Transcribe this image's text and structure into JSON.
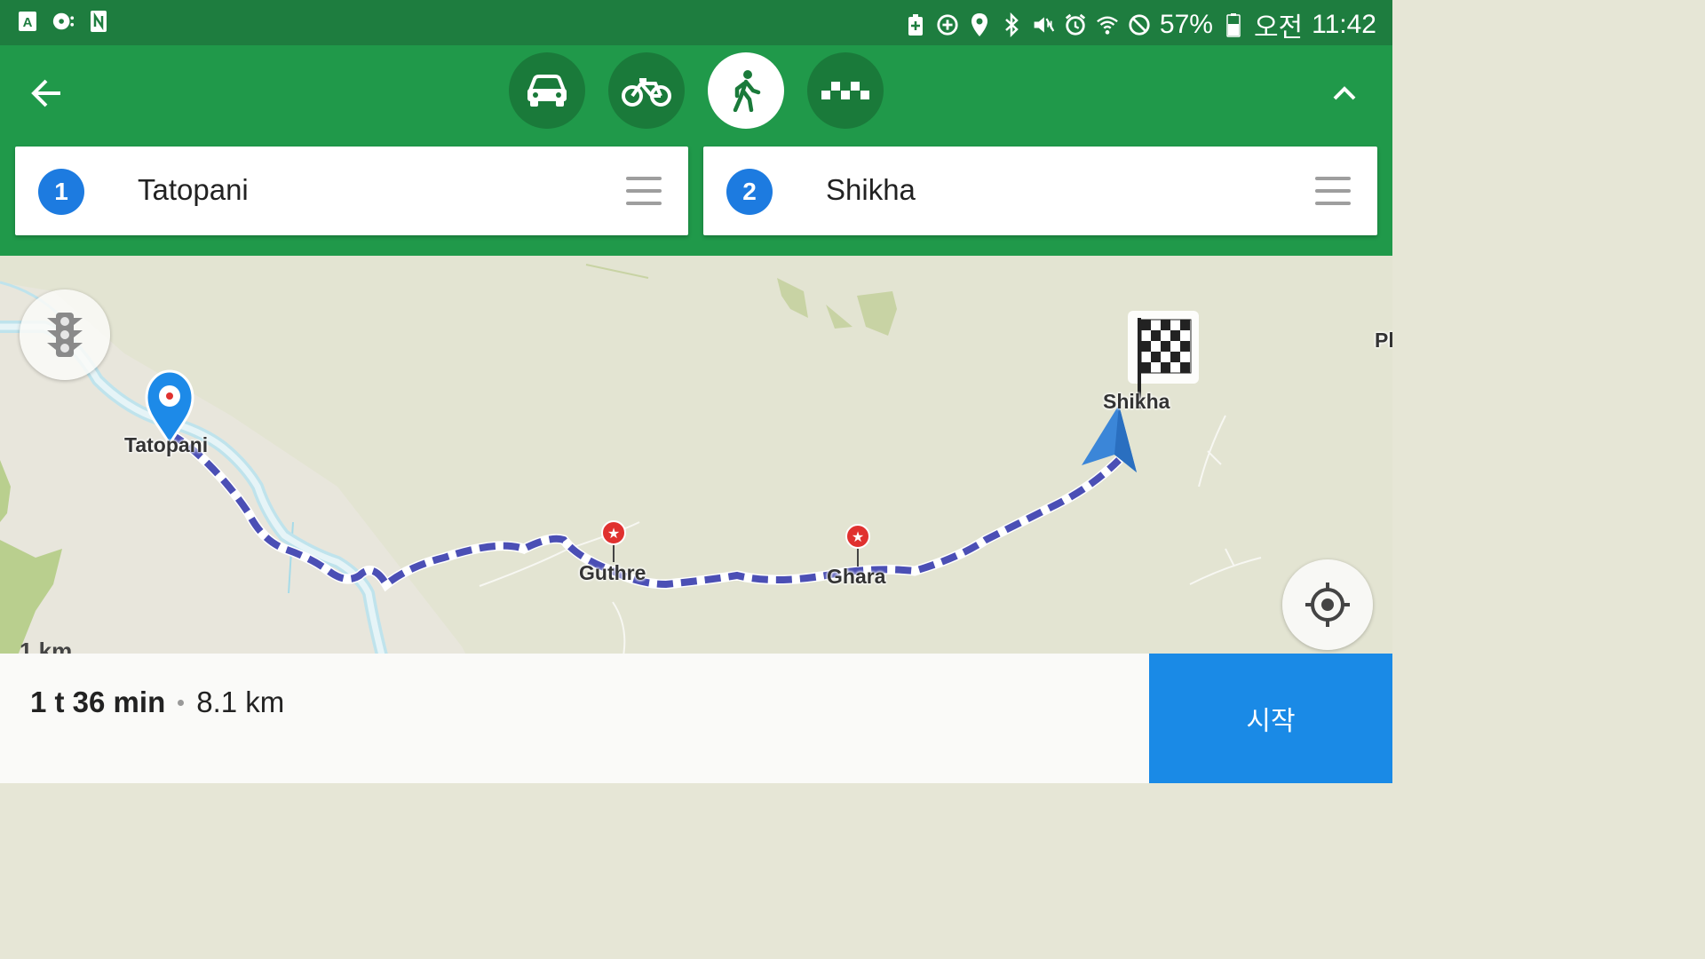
{
  "status_bar": {
    "battery": "57%",
    "ampm": "오전",
    "time": "11:42",
    "icons": [
      "a-icon",
      "media-icon",
      "n-icon",
      "battery-saver-icon",
      "data-saver-icon",
      "location-icon",
      "bluetooth-icon",
      "mute-icon",
      "alarm-icon",
      "wifi-icon",
      "dnd-icon",
      "battery-icon"
    ]
  },
  "toolbar": {
    "modes": [
      {
        "name": "car",
        "icon": "car-icon",
        "active": false
      },
      {
        "name": "bicycle",
        "icon": "bicycle-icon",
        "active": false
      },
      {
        "name": "walk",
        "icon": "walk-icon",
        "active": true
      },
      {
        "name": "taxi",
        "icon": "taxi-icon",
        "active": false
      }
    ]
  },
  "stops": [
    {
      "number": "1",
      "name": "Tatopani"
    },
    {
      "number": "2",
      "name": "Shikha"
    }
  ],
  "map": {
    "labels": {
      "tatopani": "Tatopani",
      "guthre": "Guthre",
      "ghara": "Ghara",
      "shikha": "Shikha",
      "edge": "Pl"
    },
    "scale": "1 km"
  },
  "summary": {
    "duration": "1 t 36 min",
    "distance": "8.1 km"
  },
  "start_button": "시작",
  "colors": {
    "status_bar": "#1e7d3f",
    "toolbar": "#20994a",
    "stop_badge": "#1d7be0",
    "route": "#3f51b5",
    "start_button": "#1a8ae6"
  }
}
